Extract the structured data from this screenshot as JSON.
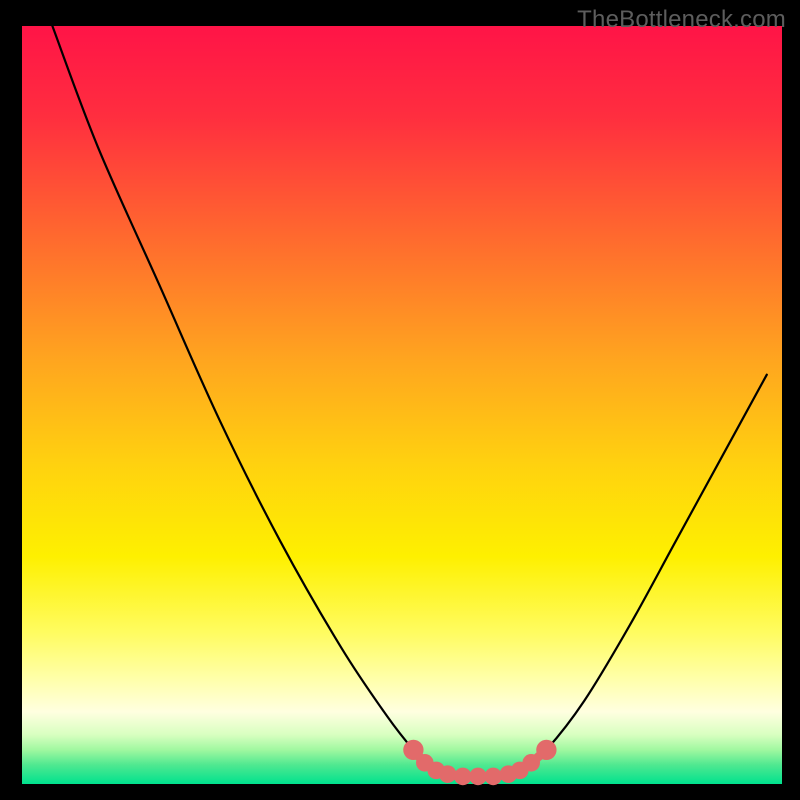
{
  "watermark": "TheBottleneck.com",
  "chart_data": {
    "type": "line",
    "title": "",
    "xlabel": "",
    "ylabel": "",
    "xlim": [
      0,
      100
    ],
    "ylim": [
      0,
      100
    ],
    "gradient_stops": [
      {
        "offset": 0.0,
        "color": "#ff1447"
      },
      {
        "offset": 0.12,
        "color": "#ff2e3f"
      },
      {
        "offset": 0.28,
        "color": "#ff6a2e"
      },
      {
        "offset": 0.44,
        "color": "#ffa51f"
      },
      {
        "offset": 0.58,
        "color": "#ffd20f"
      },
      {
        "offset": 0.7,
        "color": "#fef000"
      },
      {
        "offset": 0.8,
        "color": "#fffc60"
      },
      {
        "offset": 0.86,
        "color": "#ffffa8"
      },
      {
        "offset": 0.905,
        "color": "#ffffe0"
      },
      {
        "offset": 0.935,
        "color": "#d8ffc0"
      },
      {
        "offset": 0.955,
        "color": "#a0f8a0"
      },
      {
        "offset": 0.975,
        "color": "#4fe890"
      },
      {
        "offset": 1.0,
        "color": "#00e28e"
      }
    ],
    "series": [
      {
        "name": "curve",
        "points": [
          {
            "x": 4.0,
            "y": 100.0
          },
          {
            "x": 10.0,
            "y": 84.0
          },
          {
            "x": 18.0,
            "y": 66.0
          },
          {
            "x": 26.0,
            "y": 48.0
          },
          {
            "x": 34.0,
            "y": 32.0
          },
          {
            "x": 42.0,
            "y": 18.0
          },
          {
            "x": 48.0,
            "y": 9.0
          },
          {
            "x": 51.5,
            "y": 4.5
          },
          {
            "x": 54.0,
            "y": 2.0
          },
          {
            "x": 58.0,
            "y": 1.0
          },
          {
            "x": 62.0,
            "y": 1.0
          },
          {
            "x": 66.0,
            "y": 2.0
          },
          {
            "x": 69.0,
            "y": 4.5
          },
          {
            "x": 74.0,
            "y": 11.0
          },
          {
            "x": 80.0,
            "y": 21.0
          },
          {
            "x": 86.0,
            "y": 32.0
          },
          {
            "x": 92.0,
            "y": 43.0
          },
          {
            "x": 98.0,
            "y": 54.0
          }
        ]
      }
    ],
    "markers": [
      {
        "x": 51.5,
        "y": 4.5,
        "r": 0.9
      },
      {
        "x": 53.0,
        "y": 2.8,
        "r": 0.7
      },
      {
        "x": 54.5,
        "y": 1.8,
        "r": 0.7
      },
      {
        "x": 56.0,
        "y": 1.3,
        "r": 0.7
      },
      {
        "x": 58.0,
        "y": 1.0,
        "r": 0.7
      },
      {
        "x": 60.0,
        "y": 1.0,
        "r": 0.7
      },
      {
        "x": 62.0,
        "y": 1.0,
        "r": 0.7
      },
      {
        "x": 64.0,
        "y": 1.3,
        "r": 0.7
      },
      {
        "x": 65.5,
        "y": 1.8,
        "r": 0.7
      },
      {
        "x": 67.0,
        "y": 2.8,
        "r": 0.7
      },
      {
        "x": 69.0,
        "y": 4.5,
        "r": 0.9
      }
    ],
    "segment_color": "#e26a6a",
    "curve_color": "#000000"
  }
}
